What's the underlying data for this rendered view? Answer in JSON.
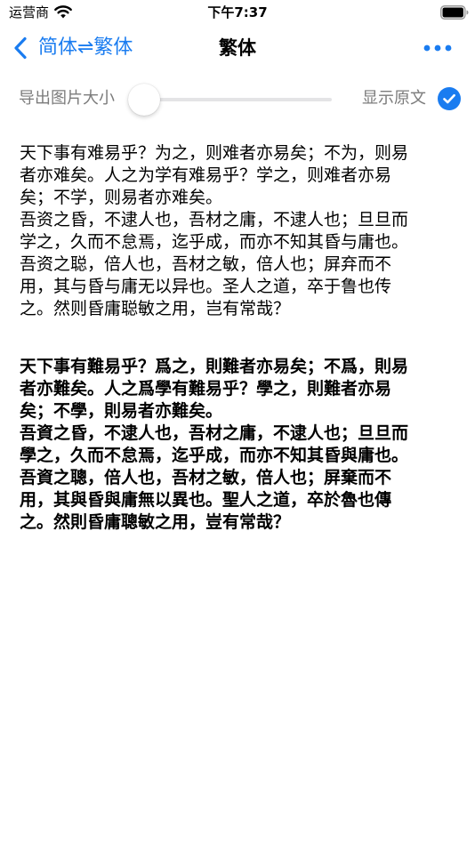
{
  "status_bar": {
    "carrier": "运营商",
    "time": "下午7:37"
  },
  "nav": {
    "back_label": "简体⇌繁体",
    "title": "繁体"
  },
  "controls": {
    "size_label": "导出图片大小",
    "size_slider_value": 0,
    "show_original_label": "显示原文",
    "show_original_checked": true
  },
  "colors": {
    "accent": "#1a7cf0",
    "secondary_text": "#7b7b7b"
  },
  "content": {
    "simplified_lines": [
      "天下事有难易乎？为之，则难者亦易矣；不为，则易",
      "者亦难矣。人之为学有难易乎？学之，则难者亦易",
      "矣；不学，则易者亦难矣。",
      "吾资之昏，不逮人也，吾材之庸，不逮人也；旦旦而",
      "学之，久而不怠焉，迄乎成，而亦不知其昏与庸也。",
      "吾资之聪，倍人也，吾材之敏，倍人也；屏弃而不",
      "用，其与昏与庸无以异也。圣人之道，卒于鲁也传",
      "之。然则昏庸聪敏之用，岂有常哉？"
    ],
    "traditional_lines": [
      "天下事有難易乎？爲之，則難者亦易矣；不爲，則易",
      "者亦難矣。人之爲學有難易乎？學之，則難者亦易",
      "矣；不學，則易者亦難矣。",
      "吾資之昏，不逮人也，吾材之庸，不逮人也；旦旦而",
      "學之，久而不怠焉，迄乎成，而亦不知其昏與庸也。",
      "吾資之聰，倍人也，吾材之敏，倍人也；屏棄而不",
      "用，其與昏與庸無以異也。聖人之道，卒於魯也傳",
      "之。然則昏庸聰敏之用，豈有常哉？"
    ]
  }
}
